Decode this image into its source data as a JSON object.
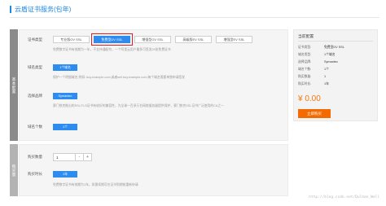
{
  "page": {
    "title": "云盾证书服务(包年)"
  },
  "side_tabs": {
    "tab1": "基本配置",
    "tab2": "购买量"
  },
  "config": {
    "cert_type_label": "证书类型",
    "cert_types": [
      {
        "label": "专业版OV SSL",
        "selected": false
      },
      {
        "label": "免费型DV SSL",
        "selected": true
      },
      {
        "label": "增强型OV SSL",
        "selected": false
      },
      {
        "label": "高级版EV SSL",
        "selected": false
      },
      {
        "label": "增强型EV SSL",
        "selected": false
      }
    ],
    "cert_type_hint": "免费数字证书有效期为一年，不支持通配符，一个阿里云用户最多可签发20张免费证书",
    "domain_type_label": "域名类型",
    "domain_type_value": "1个域名",
    "domain_type_hint": "保护一个明细域名,例如: buy.example.com,或者sell.buy.example.com,每个域名需要单独申请签发",
    "brand_label": "选择品牌",
    "brand_value": "Symantec",
    "brand_hint": "赛门铁克推出的SSL/TLS证书有较好的兼容性，为全球一百多万台网络服务器提供保护，赛门铁克SSL证书广泛使用的CA之一",
    "domain_count_label": "域名个数",
    "domain_count_value": "1个"
  },
  "purchase": {
    "qty_label": "购买数量",
    "qty_value": "1",
    "qty_minus": "-",
    "qty_plus": "+",
    "duration_label": "购买时长",
    "duration_value": "1年",
    "duration_hint": "免费数字证书有效期为1年，如需续期可在证书到期前重新申请"
  },
  "summary": {
    "title": "当前配置",
    "rows": [
      {
        "k": "证书类型:",
        "v": "免费型DV SSL"
      },
      {
        "k": "域名类型:",
        "v": "1个域名"
      },
      {
        "k": "选择品牌:",
        "v": "Symantec"
      },
      {
        "k": "域名个数:",
        "v": "1个"
      },
      {
        "k": "购买数量:",
        "v": "1"
      },
      {
        "k": "购买时长:",
        "v": "1年"
      }
    ],
    "price": "¥ 0.00",
    "buy_label": "立即购买"
  },
  "watermark": "http://blog.csdn.net/Dulhan_Well",
  "colors": {
    "accent": "#2d8cf0",
    "buy": "#f56a00",
    "price": "#f6780a",
    "highlight": "#e02020"
  }
}
